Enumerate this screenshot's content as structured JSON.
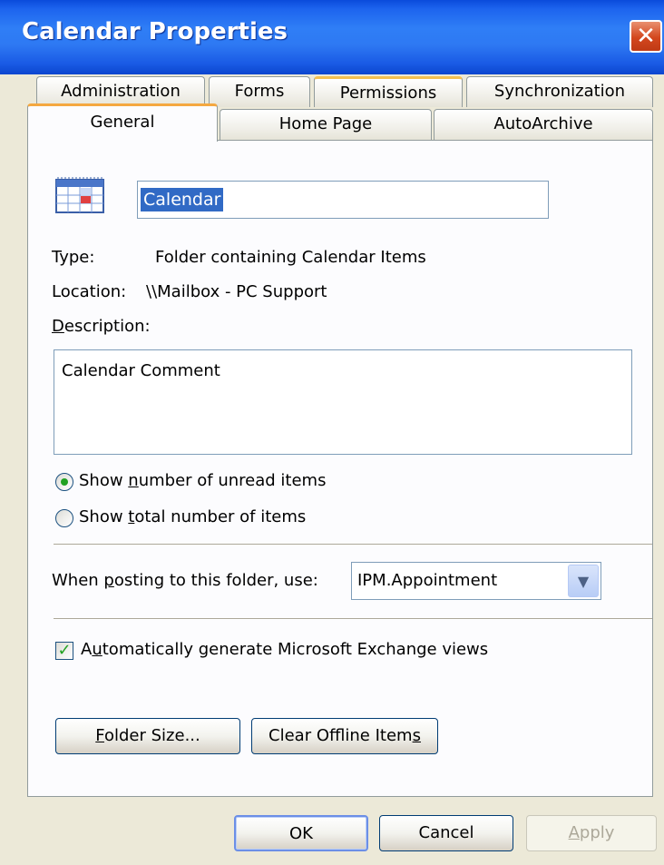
{
  "window": {
    "title": "Calendar Properties",
    "close_glyph": "✕"
  },
  "tabs_back": [
    {
      "label": "Administration"
    },
    {
      "label": "Forms"
    },
    {
      "label": "Permissions"
    },
    {
      "label": "Synchronization"
    }
  ],
  "tabs_front": [
    {
      "label": "General"
    },
    {
      "label": "Home Page"
    },
    {
      "label": "AutoArchive"
    }
  ],
  "general": {
    "folder_icon": "calendar-icon",
    "name_value": "Calendar",
    "type_label": "Type:",
    "type_value": "Folder containing Calendar Items",
    "location_label": "Location:",
    "location_value": "\\\\Mailbox - PC Support",
    "description_label_pre": "",
    "description_label_key": "D",
    "description_label_post": "escription:",
    "description_value": "Calendar Comment",
    "radio_unread": {
      "pre": "Show ",
      "key": "n",
      "post": "umber of unread items",
      "checked": true
    },
    "radio_total": {
      "pre": "Show ",
      "key": "t",
      "post": "otal number of items",
      "checked": false
    },
    "posting_label": {
      "pre": "When ",
      "key": "p",
      "post": "osting to this folder, use:"
    },
    "posting_value": "IPM.Appointment",
    "auto_views": {
      "pre": "A",
      "key": "u",
      "post": "tomatically generate Microsoft Exchange views",
      "checked": true
    },
    "folder_size_button": {
      "key": "F",
      "post": "older Size..."
    },
    "clear_offline_button": {
      "pre": "Clear Offline Item",
      "key": "s"
    }
  },
  "footer": {
    "ok": "OK",
    "cancel": "Cancel",
    "apply": {
      "key": "A",
      "post": "pply"
    }
  },
  "colors": {
    "title_bar": "#2E79F3",
    "dialog_bg": "#ECE9D8",
    "selection": "#316AC5",
    "check": "#21A121"
  }
}
